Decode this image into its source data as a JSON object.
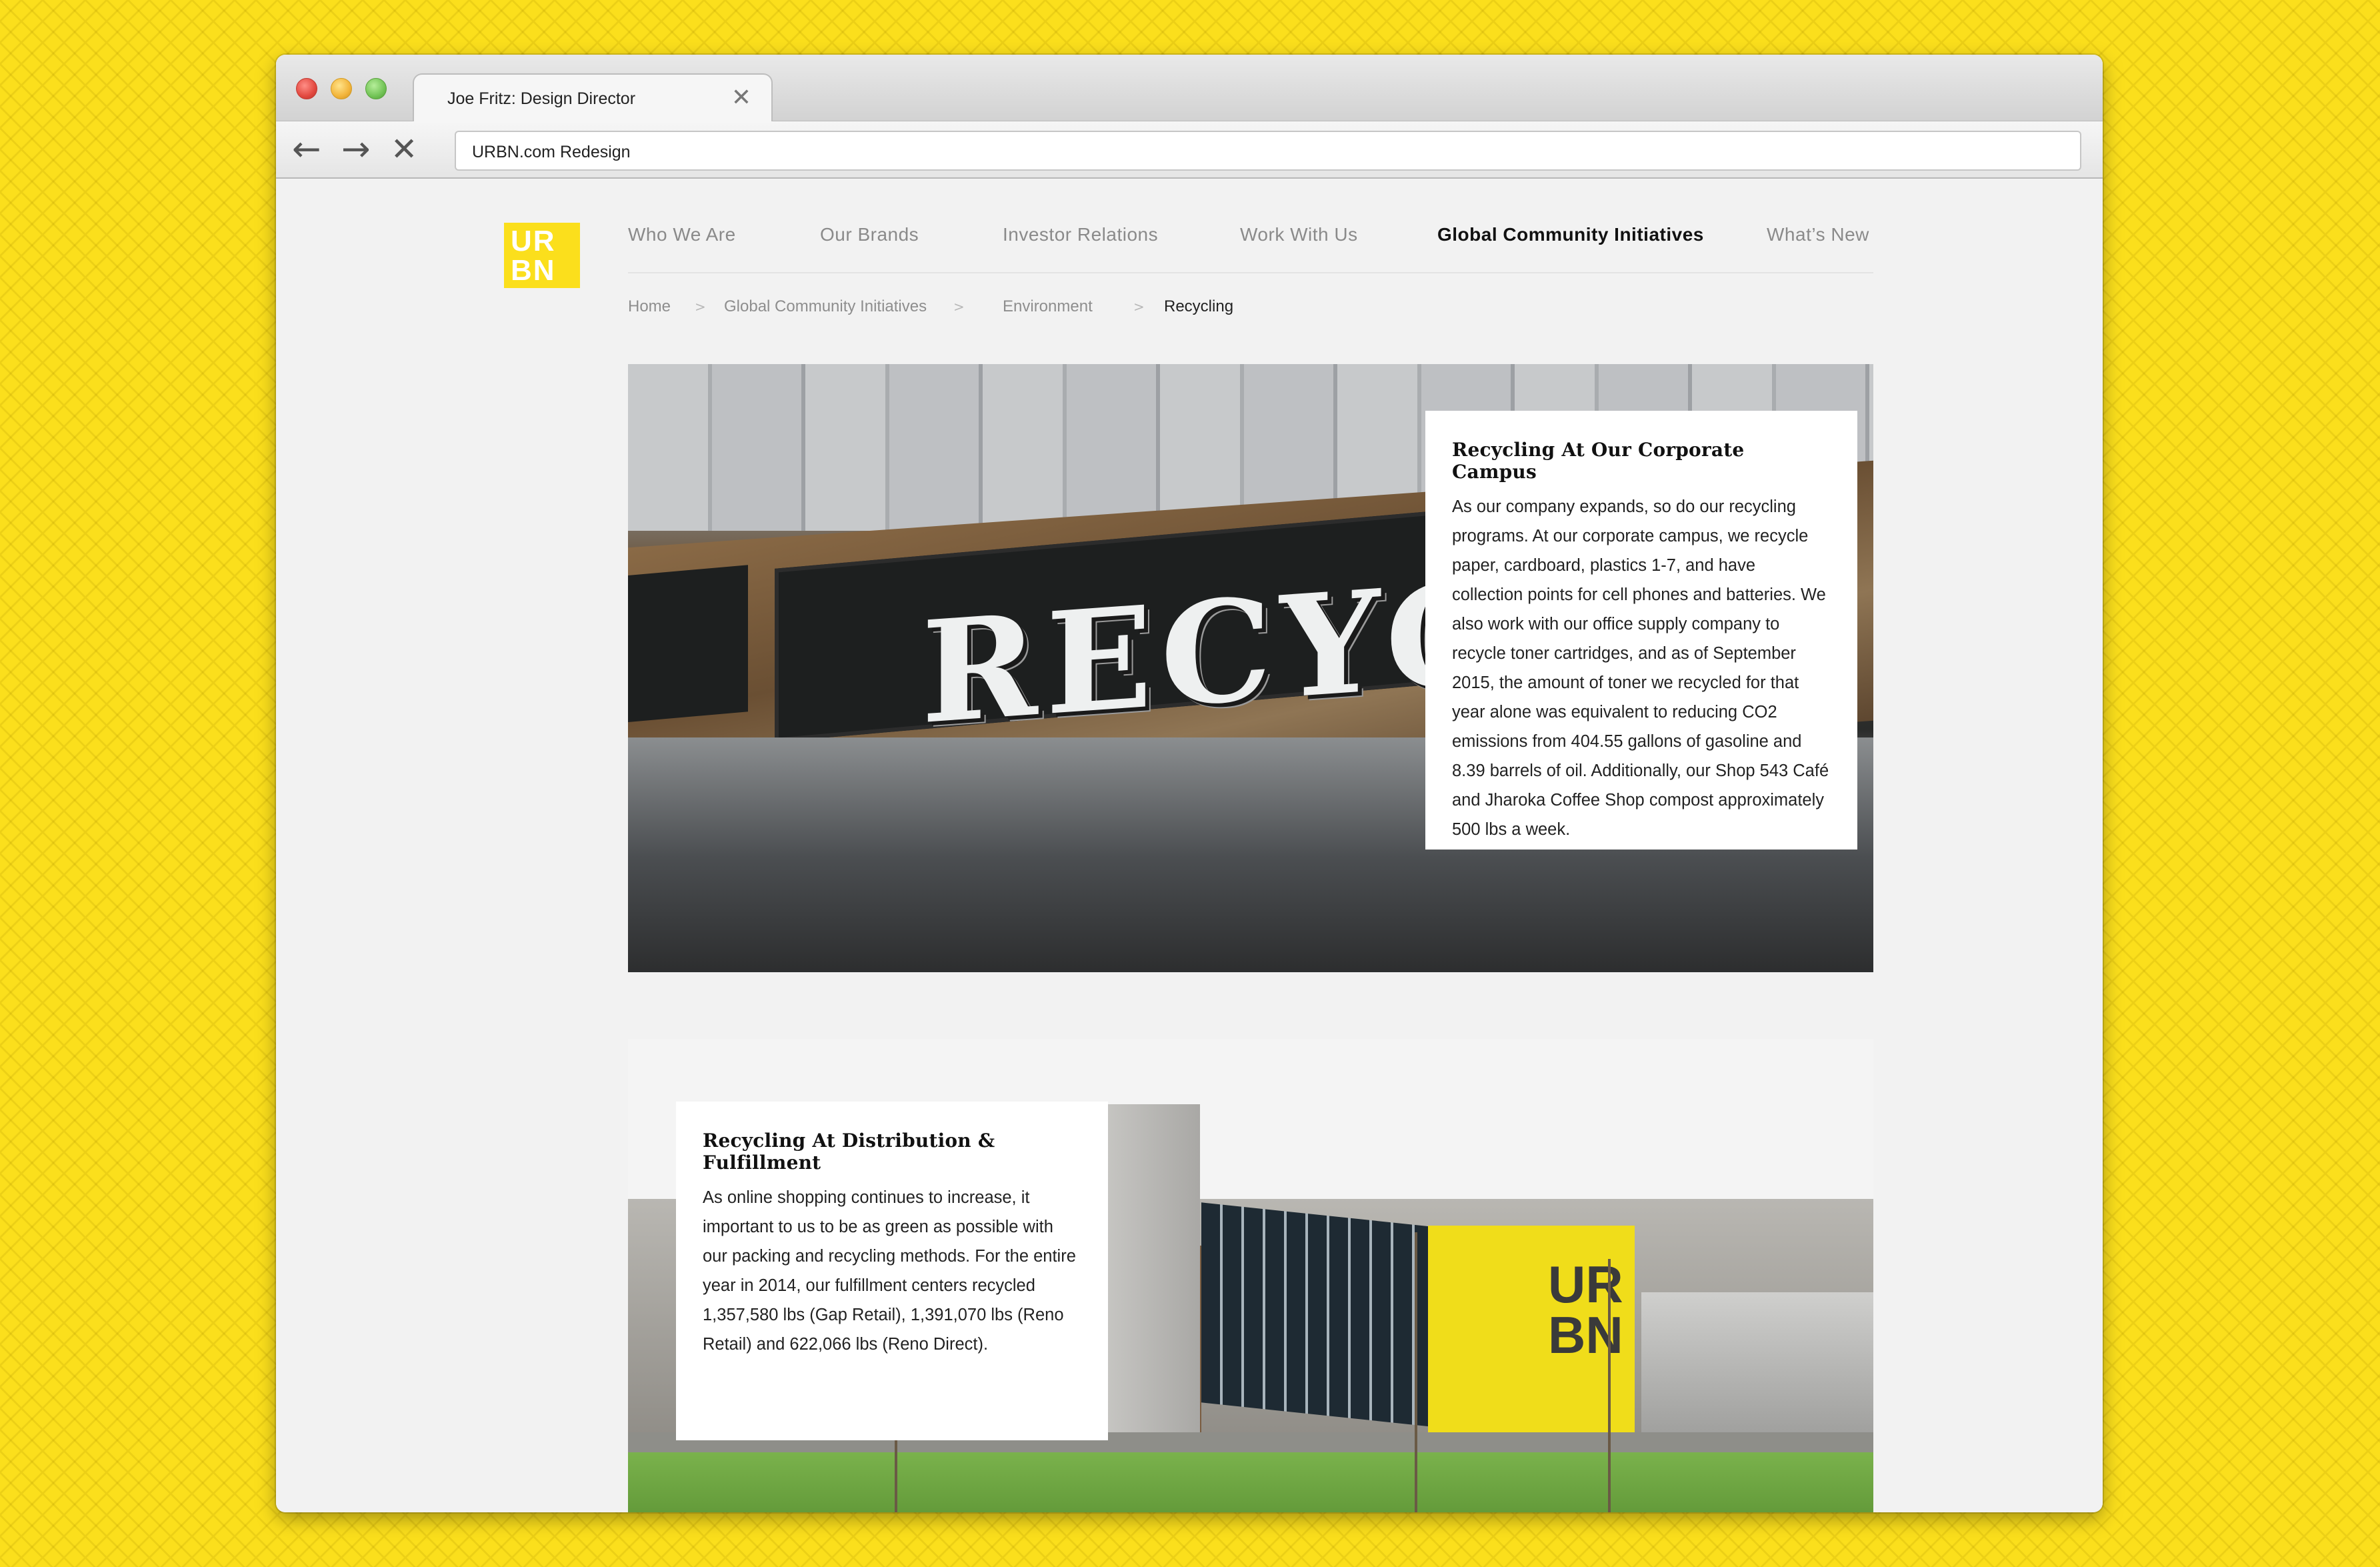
{
  "browser": {
    "tab_title": "Joe Fritz: Design Director",
    "tab_close": "✕",
    "url": "URBN.com Redesign",
    "nav": {
      "back": "←",
      "forward": "→",
      "stop": "✕"
    }
  },
  "site": {
    "logo": {
      "line1": "UR",
      "line2": "BN"
    },
    "nav": [
      {
        "label": "Who We Are",
        "active": false
      },
      {
        "label": "Our Brands",
        "active": false
      },
      {
        "label": "Investor Relations",
        "active": false
      },
      {
        "label": "Work With Us",
        "active": false
      },
      {
        "label": "Global Community Initiatives",
        "active": true
      },
      {
        "label": "What’s New",
        "active": false
      }
    ],
    "breadcrumbs": [
      "Home",
      "Global Community Initiatives",
      "Environment",
      "Recycling"
    ],
    "breadcrumb_separator": ">"
  },
  "sections": [
    {
      "title": "Recycling At Our Corporate Campus",
      "body": "As our company expands, so do our recycling programs. At our corporate campus, we recycle paper, cardboard, plastics 1-7, and have collection points for cell phones and batteries. We also work with our office supply company to recycle toner cartridges, and as of September 2015, the amount of toner we recycled for that year alone was equivalent to reducing CO2 emissions from 404.55 gallons of gasoline and 8.39 barrels of oil. Additionally, our Shop 543 Café and Jharoka Coffee Shop compost approximately 500 lbs a week.",
      "image_text": "RECYCLI"
    },
    {
      "title": "Recycling At Distribution & Fulfillment",
      "body": "As online shopping continues to increase, it important to us to be as green as possible with our packing and recycling methods. For the entire year in 2014, our fulfillment centers recycled 1,357,580 lbs (Gap Retail), 1,391,070 lbs (Reno Retail) and 622,066 lbs (Reno Direct).",
      "image_text": {
        "line1": "UR",
        "line2": "BN"
      }
    }
  ],
  "colors": {
    "background": "#fbdf1c",
    "brand_yellow": "#fbdf1c",
    "nav_inactive": "#8a8a8a",
    "nav_active": "#111111"
  }
}
